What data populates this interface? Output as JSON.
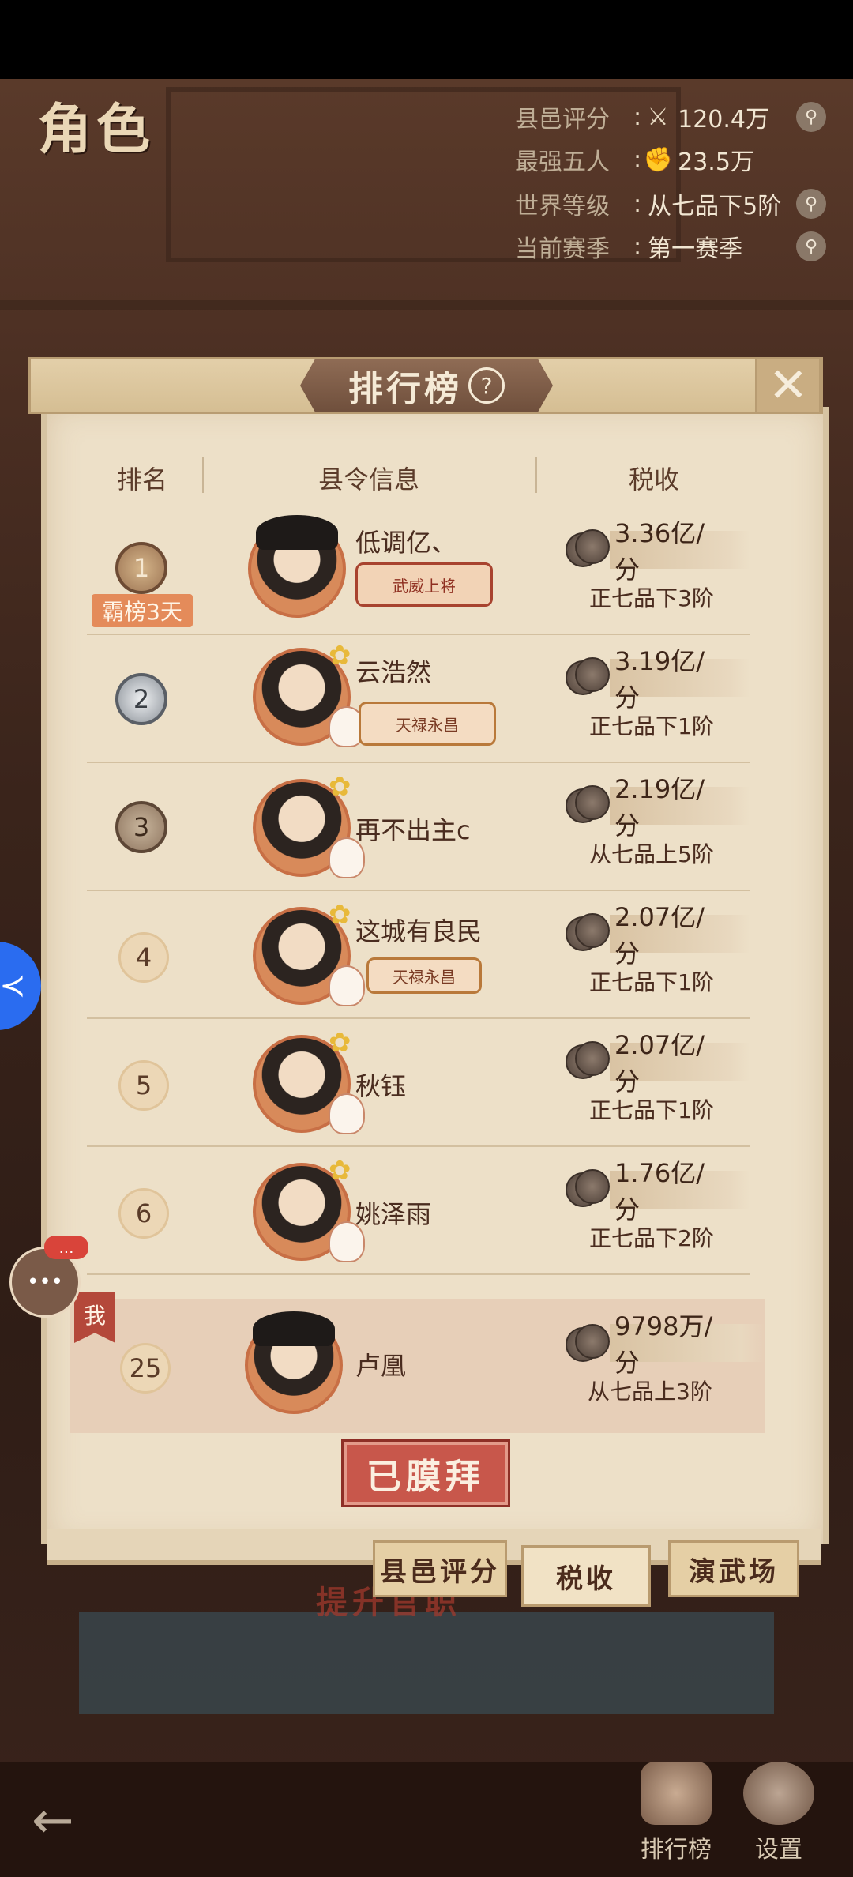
{
  "header": {
    "role_title": "角色",
    "stats": [
      {
        "label": "县邑评分",
        "sep": ":",
        "icon": "sword-icon",
        "value": "120.4万",
        "searchable": true
      },
      {
        "label": "最强五人",
        "sep": ":",
        "icon": "fist-icon",
        "value": "23.5万",
        "searchable": false
      },
      {
        "label": "世界等级",
        "sep": ":",
        "icon": "",
        "value": "从七品下5阶",
        "searchable": true
      },
      {
        "label": "当前赛季",
        "sep": ":",
        "icon": "",
        "value": "第一赛季",
        "searchable": true
      }
    ]
  },
  "panel": {
    "title": "排行榜",
    "help": "?",
    "close": "✕",
    "columns": [
      "排名",
      "县令信息",
      "税收"
    ],
    "rows": [
      {
        "rank": "1",
        "tag": "霸榜3天",
        "name": "低调亿、",
        "title_badge": "武威上将",
        "tax": "3.36亿/分",
        "grade": "正七品下3阶"
      },
      {
        "rank": "2",
        "name": "云浩然",
        "title_badge": "天禄永昌",
        "tax": "3.19亿/分",
        "grade": "正七品下1阶"
      },
      {
        "rank": "3",
        "name": "再不出主c",
        "title_badge": "",
        "tax": "2.19亿/分",
        "grade": "从七品上5阶"
      },
      {
        "rank": "4",
        "name": "这城有良民",
        "title_badge": "天禄永昌",
        "tax": "2.07亿/分",
        "grade": "正七品下1阶"
      },
      {
        "rank": "5",
        "name": "秋钰",
        "title_badge": "",
        "tax": "2.07亿/分",
        "grade": "正七品下1阶"
      },
      {
        "rank": "6",
        "name": "姚泽雨",
        "title_badge": "",
        "tax": "1.76亿/分",
        "grade": "正七品下2阶"
      }
    ],
    "me": {
      "flag": "我",
      "rank": "25",
      "name": "卢凰",
      "tax": "9798万/分",
      "grade": "从七品上3阶"
    },
    "worship_button": "已膜拜",
    "tabs": [
      "县邑评分",
      "税收",
      "演武场"
    ]
  },
  "background": {
    "promote_text": "提升官职"
  },
  "nav": {
    "back": "←",
    "items": [
      {
        "label": "排行榜",
        "icon": "ranking-icon"
      },
      {
        "label": "设置",
        "icon": "settings-icon"
      }
    ]
  },
  "floating": {
    "side_icon": "≺",
    "chat_dots": "•••",
    "chat_badge": "..."
  },
  "colors": {
    "accent_red": "#c8574b",
    "panel_bg": "#ede0c8",
    "me_row": "#e7cfb8",
    "first_tag": "#e48b5a"
  }
}
